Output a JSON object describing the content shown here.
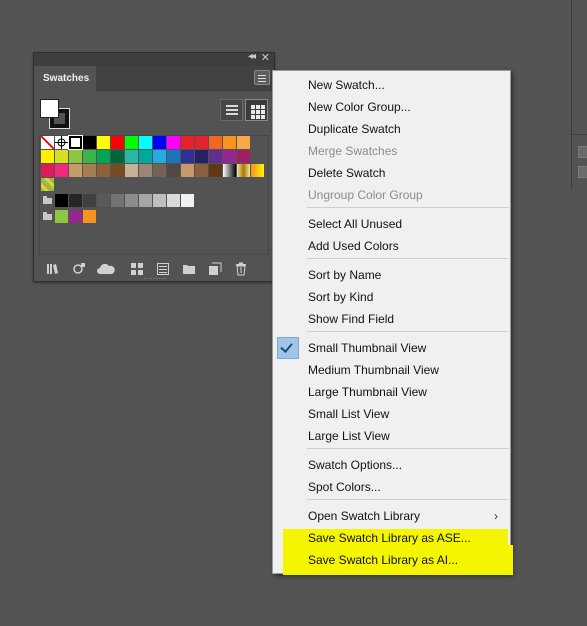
{
  "panel": {
    "title": "Swatches",
    "collapse_icon": "double-chevron-left-icon",
    "close_icon": "close-icon",
    "menu_icon": "hamburger-menu-icon",
    "view_buttons": [
      "list-view-icon",
      "thumbnail-view-icon"
    ],
    "footer_icons": [
      "swatch-libraries-menu-icon",
      "add-selected-to-group-icon",
      "cloud-library-icon",
      "show-swatch-kinds-icon",
      "swatch-options-icon",
      "new-color-group-icon",
      "new-swatch-icon",
      "delete-swatch-icon"
    ],
    "swatch_rows": [
      [
        "none",
        "registration",
        "white",
        "#000000",
        "#ffff00",
        "#ff0000",
        "#00ff00",
        "#00ffff",
        "#0000ff",
        "#ff00ff",
        "#e4212d",
        "#e4212d",
        "#f26522",
        "#f7941d",
        "#f7a94a"
      ],
      [
        "#fff200",
        "#d7df23",
        "#8dc63f",
        "#39b54a",
        "#00a651",
        "#006838",
        "#2ab6a8",
        "#00a79d",
        "#27aae1",
        "#1c75bc",
        "#2e3192",
        "#262262",
        "#662d91",
        "#92278f",
        "#9e1f63"
      ],
      [
        "#da1c5c",
        "#ee2a7b",
        "#c69c6d",
        "#a67c52",
        "#8c6239",
        "#754c24",
        "#c7b299",
        "#998675",
        "#736357",
        "#534741",
        "#c49a6c",
        "#8b5e3c",
        "#603913",
        "gradient-bw",
        "gradient-gold",
        "gradient-orange"
      ],
      [
        "pattern"
      ],
      [
        "folder",
        "#000000",
        "#262626",
        "#404040",
        "#595959",
        "#737373",
        "#8c8c8c",
        "#a6a6a6",
        "#bfbfbf",
        "#d9d9d9",
        "#f2f2f2"
      ],
      [
        "folder",
        "#8dc63f",
        "#92278f",
        "#f7941d"
      ]
    ]
  },
  "menu": {
    "items": [
      {
        "label": "New Swatch...",
        "disabled": false
      },
      {
        "label": "New Color Group...",
        "disabled": false
      },
      {
        "label": "Duplicate Swatch",
        "disabled": false
      },
      {
        "label": "Merge Swatches",
        "disabled": true
      },
      {
        "label": "Delete Swatch",
        "disabled": false
      },
      {
        "label": "Ungroup Color Group",
        "disabled": true
      },
      {
        "label": "Select All Unused",
        "disabled": false
      },
      {
        "label": "Add Used Colors",
        "disabled": false
      },
      {
        "label": "Sort by Name",
        "disabled": false
      },
      {
        "label": "Sort by Kind",
        "disabled": false
      },
      {
        "label": "Show Find Field",
        "disabled": false
      },
      {
        "label": "Small Thumbnail View",
        "disabled": false,
        "checked": true
      },
      {
        "label": "Medium Thumbnail View",
        "disabled": false
      },
      {
        "label": "Large Thumbnail View",
        "disabled": false
      },
      {
        "label": "Small List View",
        "disabled": false
      },
      {
        "label": "Large List View",
        "disabled": false
      },
      {
        "label": "Swatch Options...",
        "disabled": false
      },
      {
        "label": "Spot Colors...",
        "disabled": false
      },
      {
        "label": "Open Swatch Library",
        "disabled": false,
        "submenu": true
      },
      {
        "label": "Save Swatch Library as ASE...",
        "disabled": false,
        "highlighted": true
      },
      {
        "label": "Save Swatch Library as AI...",
        "disabled": false,
        "highlighted": true
      }
    ],
    "check_icon": "checkmark-icon",
    "submenu_arrow": "›"
  },
  "colors": {
    "app_bg": "#535353",
    "menu_bg": "#f0f0f0",
    "check_bg": "#9fc6e8",
    "highlight": "#f5f500"
  }
}
